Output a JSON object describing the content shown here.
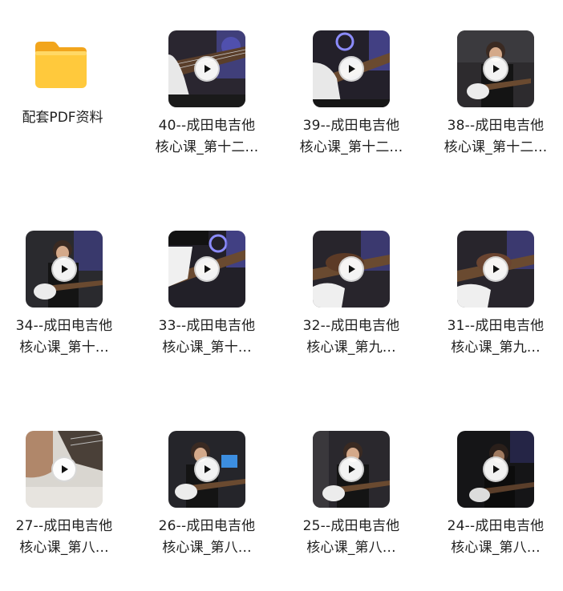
{
  "folder": {
    "name": "配套PDF资料",
    "icon": "folder-icon"
  },
  "videos": [
    {
      "line1": "40--成田电吉他",
      "line2": "核心课_第十二...",
      "icon": "play-icon"
    },
    {
      "line1": "39--成田电吉他",
      "line2": "核心课_第十二...",
      "icon": "play-icon"
    },
    {
      "line1": "38--成田电吉他",
      "line2": "核心课_第十二...",
      "icon": "play-icon"
    },
    {
      "line1": "34--成田电吉他",
      "line2": "核心课_第十...",
      "icon": "play-icon"
    },
    {
      "line1": "33--成田电吉他",
      "line2": "核心课_第十...",
      "icon": "play-icon"
    },
    {
      "line1": "32--成田电吉他",
      "line2": "核心课_第九...",
      "icon": "play-icon"
    },
    {
      "line1": "31--成田电吉他",
      "line2": "核心课_第九...",
      "icon": "play-icon"
    },
    {
      "line1": "27--成田电吉他",
      "line2": "核心课_第八...",
      "icon": "play-icon"
    },
    {
      "line1": "26--成田电吉他",
      "line2": "核心课_第八...",
      "icon": "play-icon"
    },
    {
      "line1": "25--成田电吉他",
      "line2": "核心课_第八...",
      "icon": "play-icon"
    },
    {
      "line1": "24--成田电吉他",
      "line2": "核心课_第八...",
      "icon": "play-icon"
    }
  ],
  "colors": {
    "folder_main": "#FFC83D",
    "folder_back": "#F4A81F",
    "text": "#1f1f1f"
  }
}
